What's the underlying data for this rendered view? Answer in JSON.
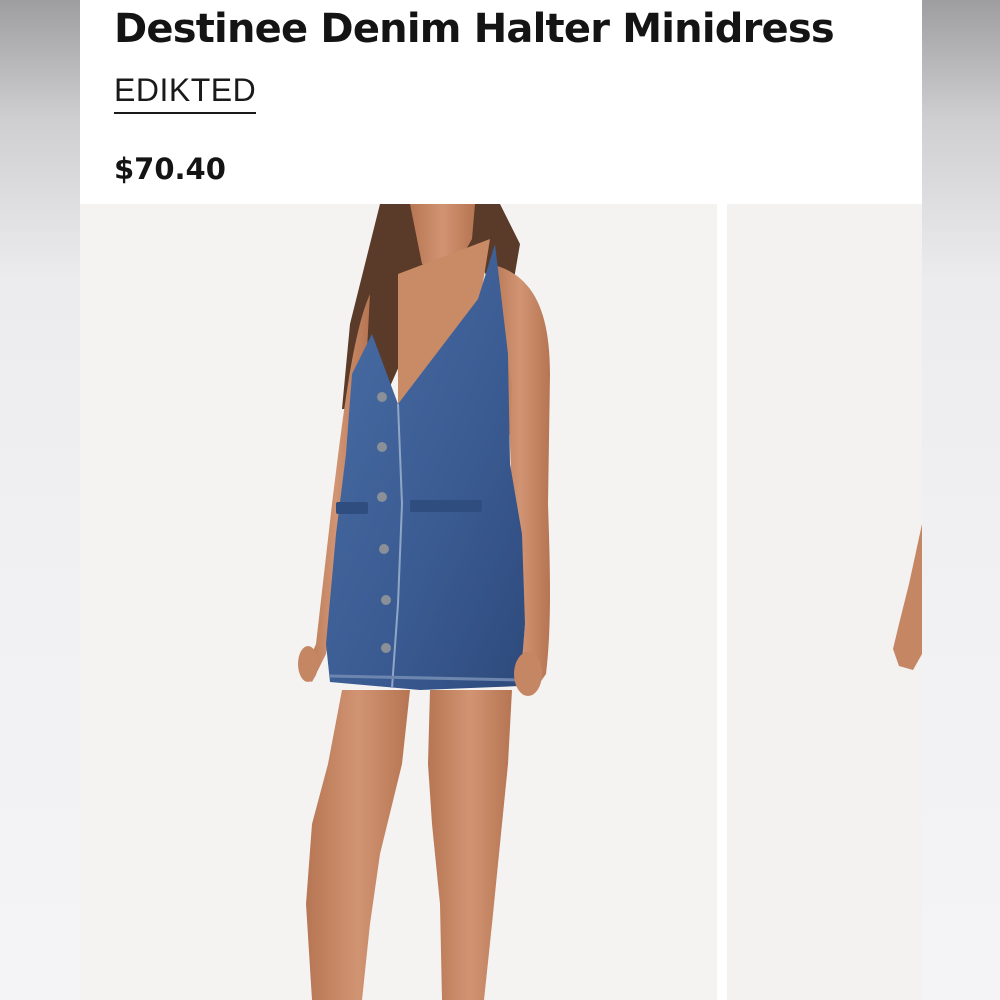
{
  "product": {
    "title": "Destinee Denim Halter Minidress",
    "brand": "EDIKTED",
    "price": "$70.40"
  },
  "gallery": {
    "images": [
      {
        "name": "product-photo-main",
        "description": "model-wearing-denim-halter-minidress-front"
      },
      {
        "name": "product-photo-next",
        "description": "partial-second-product-photo"
      }
    ]
  },
  "colors": {
    "denim": "#3d5f95",
    "denim_dark": "#2f4d7e",
    "skin": "#c98a66",
    "hair": "#5a3a28",
    "background_photo": "#f4f3f2"
  }
}
